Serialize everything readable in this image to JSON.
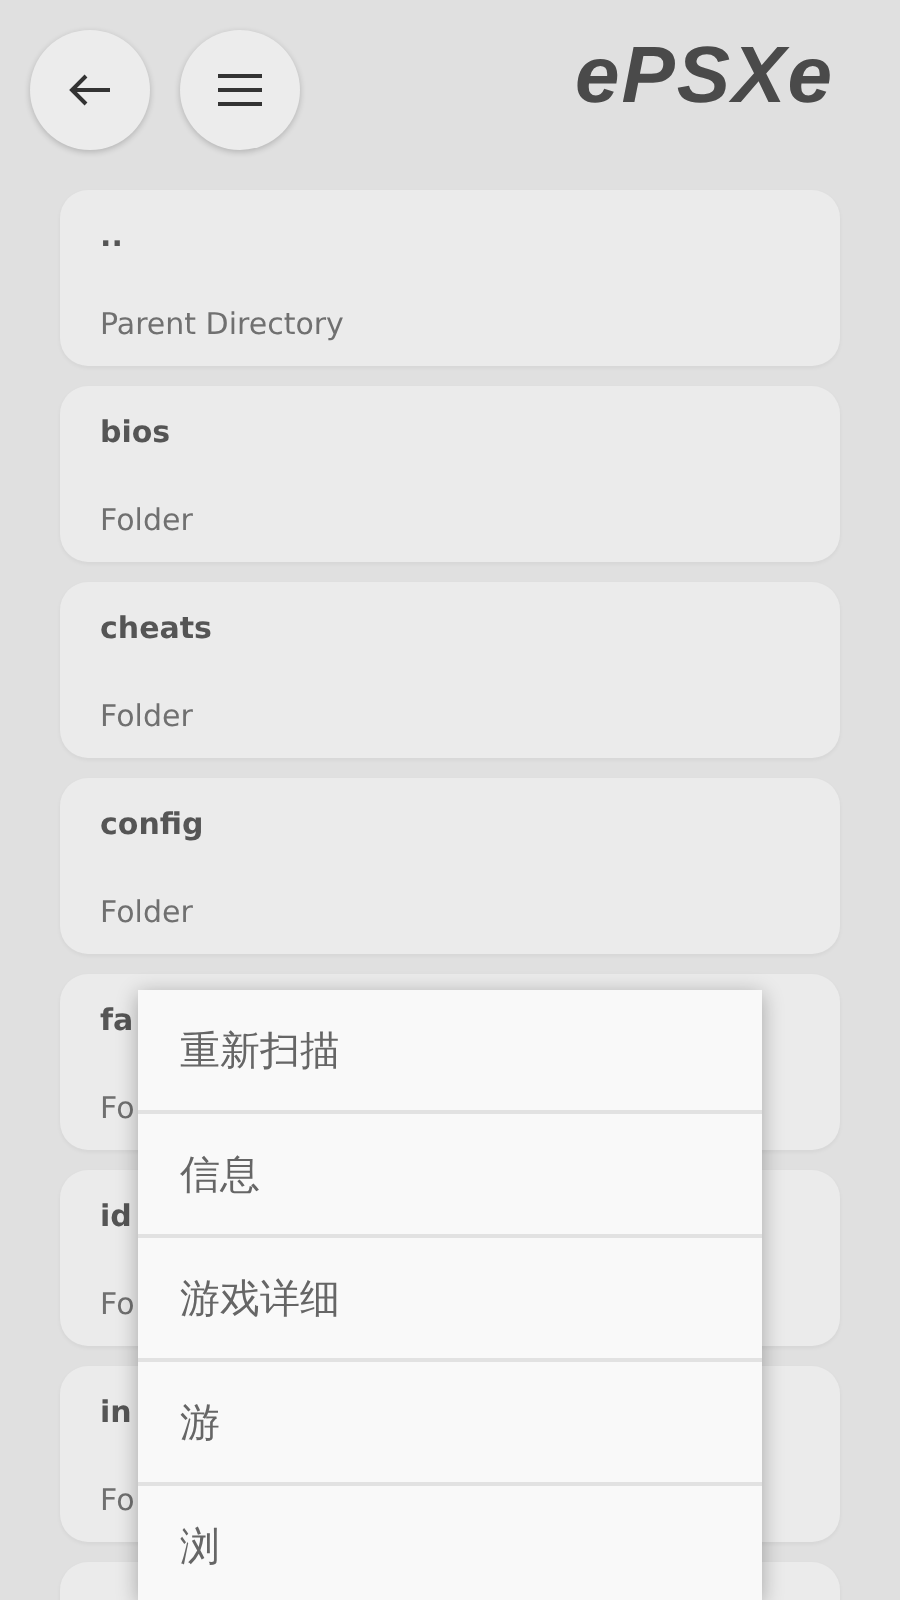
{
  "header": {
    "logo": "ePSXe"
  },
  "files": [
    {
      "name": "..",
      "type": "Parent Directory"
    },
    {
      "name": "bios",
      "type": "Folder"
    },
    {
      "name": "cheats",
      "type": "Folder"
    },
    {
      "name": "config",
      "type": "Folder"
    },
    {
      "name": "fa",
      "type": "Fo"
    },
    {
      "name": "id",
      "type": "Fo"
    },
    {
      "name": "in",
      "type": "Fo"
    }
  ],
  "context_menu": {
    "items": [
      "重新扫描",
      "信息",
      "游戏详细",
      "游",
      "浏"
    ]
  }
}
